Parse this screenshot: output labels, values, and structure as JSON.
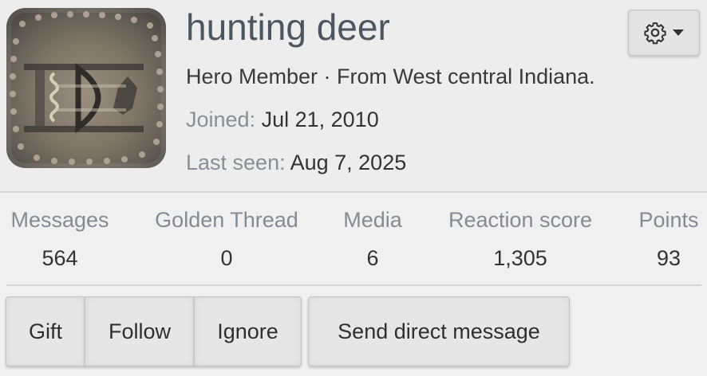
{
  "profile": {
    "username": "hunting deer",
    "role": "Hero Member",
    "separator": " · ",
    "location_prefix": "From ",
    "location": "West central Indiana.",
    "joined_label": "Joined:",
    "joined_value": "Jul 21, 2010",
    "last_seen_label": "Last seen:",
    "last_seen_value": "Aug 7, 2025",
    "avatar_icon": "coin-avatar"
  },
  "stats": [
    {
      "label": "Messages",
      "value": "564"
    },
    {
      "label": "Golden Thread",
      "value": "0"
    },
    {
      "label": "Media",
      "value": "6"
    },
    {
      "label": "Reaction score",
      "value": "1,305"
    },
    {
      "label": "Points",
      "value": "93"
    }
  ],
  "actions": {
    "gift": "Gift",
    "follow": "Follow",
    "ignore": "Ignore",
    "message": "Send direct message",
    "settings_icon": "gear-icon",
    "settings_caret_icon": "caret-down-icon"
  },
  "colors": {
    "page_bg": "#f0f0f0",
    "username": "#4c5660",
    "muted_label": "#858b92",
    "button_bg": "#e6e6e6"
  }
}
